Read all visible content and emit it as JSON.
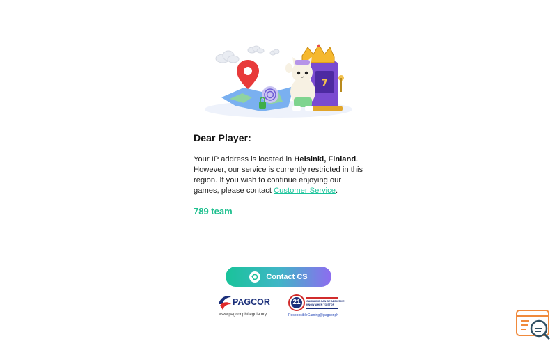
{
  "message": {
    "greeting": "Dear Player:",
    "line_prefix": "Your IP address is located in ",
    "location": "Helsinki, Finland",
    "line_suffix": ". However, our service is currently restricted in this region. If you wish to continue enjoying our games, please contact ",
    "support_link": "Customer Service",
    "end_punct": ".",
    "signature": "789 team"
  },
  "actions": {
    "contact_label": "Contact CS"
  },
  "footer": {
    "pagcor_name": "PAGCOR",
    "pagcor_url": "www.pagcor.ph/regulatory",
    "rg_age": "21",
    "rg_line1": "GAMBLING CAN BE ADDICTIVE",
    "rg_line2": "KNOW WHEN TO STOP",
    "rg_url": "ResponsibleGaming@pagcor.ph"
  },
  "icons": {
    "hero": "cat-slot-machine-illustration",
    "contact": "refresh-chat-icon",
    "support": "search-support-icon"
  },
  "colors": {
    "accent_green": "#1fc08f",
    "gradient_start": "#19c39a",
    "gradient_end": "#8e6cf0",
    "pagcor_blue": "#1b2f7a",
    "support_orange": "#f08a3c"
  }
}
